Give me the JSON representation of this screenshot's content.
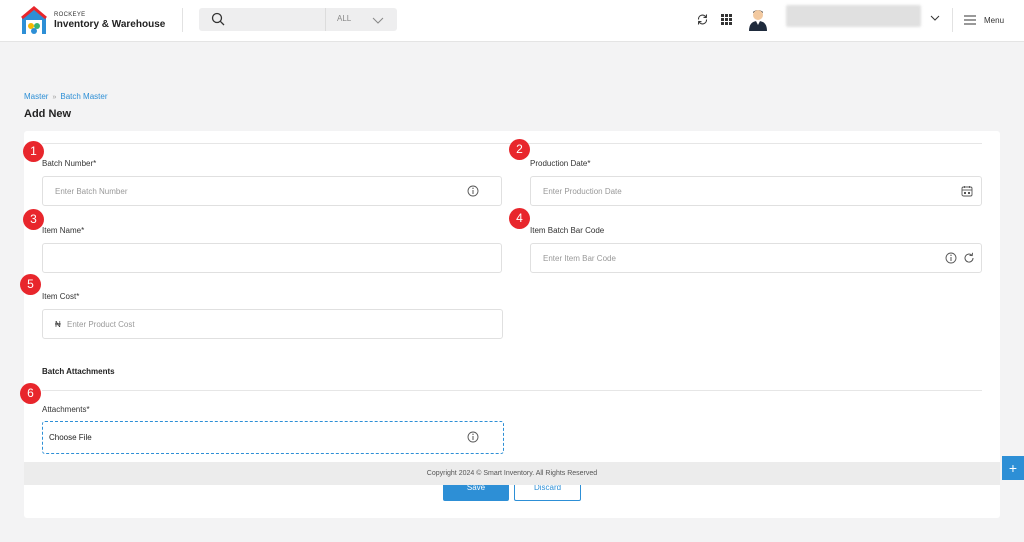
{
  "header": {
    "brand_small": "ROCKEYE",
    "brand_name": "Inventory & Warehouse",
    "search_scope": "ALL",
    "menu_label": "Menu"
  },
  "breadcrumb": {
    "root": "Master",
    "current": "Batch Master"
  },
  "page_title": "Add New",
  "form": {
    "batch_number": {
      "badge": "1",
      "label": "Batch Number*",
      "placeholder": "Enter Batch Number"
    },
    "production_date": {
      "badge": "2",
      "label": "Production Date*",
      "placeholder": "Enter Production Date"
    },
    "item_name": {
      "badge": "3",
      "label": "Item Name*",
      "value": ""
    },
    "item_barcode": {
      "badge": "4",
      "label": "Item Batch Bar Code",
      "placeholder": "Enter Item Bar Code"
    },
    "item_cost": {
      "badge": "5",
      "label": "Item Cost*",
      "currency": "₦",
      "placeholder": "Enter Product Cost"
    },
    "attachments_section": "Batch Attachments",
    "attachments": {
      "badge": "6",
      "label": "Attachments*",
      "button": "Choose File"
    }
  },
  "footer": "Copyright 2024 © Smart Inventory. All Rights Reserved",
  "actions": {
    "save": "Save",
    "discard": "Discard"
  },
  "fab": "+",
  "icons": [
    "search-icon",
    "chevron-down-icon",
    "refresh-icon",
    "apps-grid-icon",
    "hamburger-menu-icon",
    "info-icon",
    "calendar-icon"
  ],
  "colors": {
    "accent": "#2d8fd6",
    "badge": "#e8262c"
  }
}
